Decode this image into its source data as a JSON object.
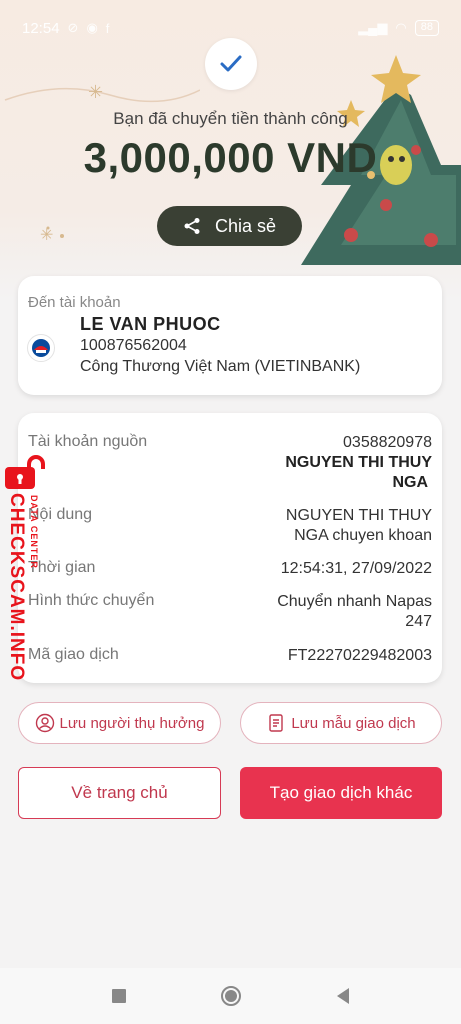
{
  "status_bar": {
    "time": "12:54",
    "battery": "88"
  },
  "header": {
    "success_message": "Bạn đã chuyển tiền thành công",
    "amount": "3,000,000 VND",
    "share_label": "Chia sẻ"
  },
  "recipient": {
    "label": "Đến tài khoản",
    "name": "LE VAN PHUOC",
    "account": "100876562004",
    "bank": "Công Thương Việt Nam (VIETINBANK)"
  },
  "details": {
    "source_label": "Tài khoản nguồn",
    "source_account": "0358820978",
    "source_name_line1": "NGUYEN THI THUY",
    "source_name_line2": "NGA",
    "content_label": "Nội dung",
    "content_line1": "NGUYEN THI THUY",
    "content_line2": "NGA chuyen khoan",
    "time_label": "Thời gian",
    "time_value": "12:54:31, 27/09/2022",
    "method_label": "Hình thức chuyển",
    "method_line1": "Chuyển nhanh Napas",
    "method_line2": "247",
    "txn_label": "Mã giao dịch",
    "txn_value": "FT22270229482003"
  },
  "actions": {
    "save_beneficiary": "Lưu người thụ hưởng",
    "save_template": "Lưu mẫu giao dịch",
    "home": "Về trang chủ",
    "new_transaction": "Tạo giao dịch khác"
  },
  "watermark": {
    "main": "CHECKSCAM.INFO",
    "sub": "DATA CENTER"
  },
  "colors": {
    "accent": "#e8334f",
    "amount": "#2c3a2c",
    "share_bg": "#3a4034",
    "check": "#2a6cc4"
  },
  "icons": [
    "check-icon",
    "share-icon",
    "person-icon",
    "receipt-icon",
    "nav-recent-icon",
    "nav-home-icon",
    "nav-back-icon",
    "lock-icon"
  ]
}
